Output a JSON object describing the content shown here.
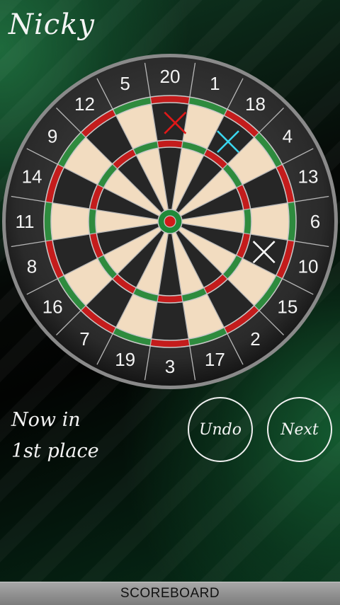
{
  "player": {
    "name": "Nicky"
  },
  "board": {
    "numbers": [
      "20",
      "1",
      "18",
      "4",
      "13",
      "6",
      "10",
      "15",
      "2",
      "17",
      "3",
      "19",
      "7",
      "16",
      "8",
      "11",
      "14",
      "9",
      "12",
      "5"
    ],
    "colors": {
      "dark": "#262626",
      "light": "#f2dcc0",
      "red": "#c41c1c",
      "green": "#2e8b3e",
      "bull_green": "#1f8a3a",
      "bull_red": "#d01a1a"
    },
    "throws": [
      {
        "label": "throw-1",
        "segment": "20",
        "ring": "single",
        "color": "#e01818"
      },
      {
        "label": "throw-2",
        "segment": "18",
        "ring": "single",
        "color": "#3ad6f0"
      },
      {
        "label": "throw-3",
        "segment": "10",
        "ring": "single",
        "color": "#ffffff"
      }
    ]
  },
  "status": {
    "line1": "Now in",
    "line2": "1st place"
  },
  "buttons": {
    "undo": "Undo",
    "next": "Next"
  },
  "footer": {
    "scoreboard": "SCOREBOARD"
  }
}
